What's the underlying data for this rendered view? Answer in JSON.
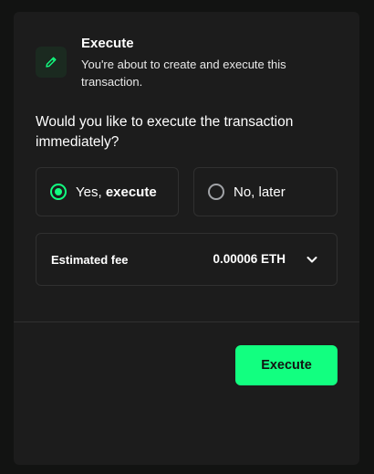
{
  "header": {
    "icon": "pencil-icon",
    "title": "Execute",
    "description": "You're about to create and execute this transaction."
  },
  "question": "Would you like to execute the transaction immediately?",
  "options": {
    "yes_prefix": "Yes, ",
    "yes_bold": "execute",
    "no_label": "No, later",
    "selected": "yes"
  },
  "fee": {
    "label": "Estimated fee",
    "value": "0.00006 ETH",
    "icon": "chevron-down-icon"
  },
  "actions": {
    "execute_label": "Execute"
  },
  "colors": {
    "accent": "#12ff80",
    "background": "#121312",
    "card": "#1c1c1c",
    "border": "#303030"
  }
}
